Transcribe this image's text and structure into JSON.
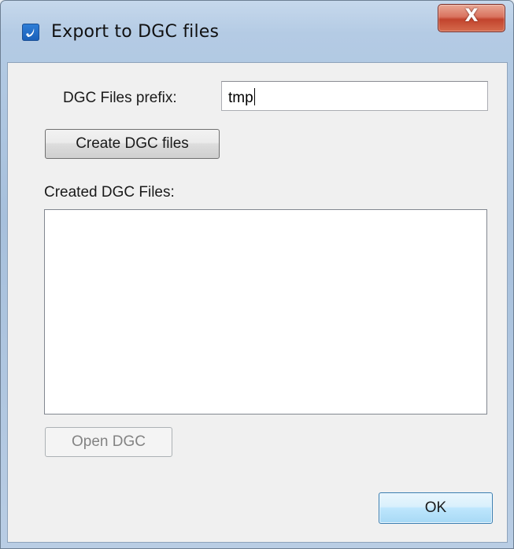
{
  "window": {
    "title": "Export to DGC files",
    "close_label": "X"
  },
  "form": {
    "prefix_label": "DGC Files prefix:",
    "prefix_value": "tmp",
    "create_button_label": "Create DGC files",
    "created_files_label": "Created DGC Files:",
    "created_files": [],
    "open_button_label": "Open DGC",
    "open_button_enabled": false,
    "ok_button_label": "OK"
  },
  "icons": {
    "app": "app-logo-icon",
    "close": "close-icon"
  },
  "colors": {
    "close_button": "#c7432d",
    "ok_button_border": "#3c7fb1",
    "client_background": "#f0f0f0"
  }
}
